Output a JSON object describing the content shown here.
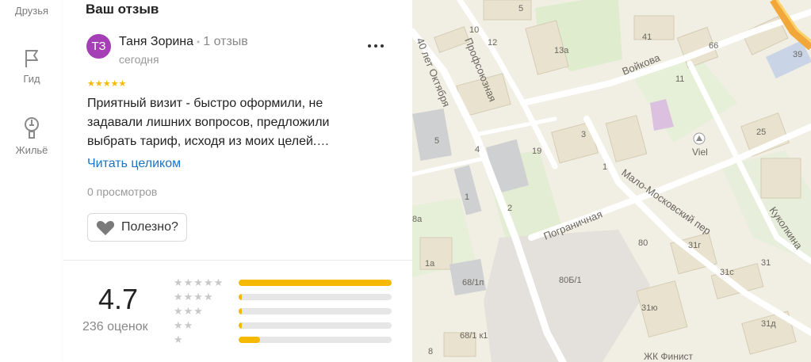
{
  "nav": {
    "friends": "Друзья",
    "guide": "Гид",
    "housing": "Жильё"
  },
  "review": {
    "section_title": "Ваш отзыв",
    "avatar_initials": "ТЗ",
    "author": "Таня Зорина",
    "author_reviews": "1 отзыв",
    "date": "сегодня",
    "stars": "★★★★★",
    "text_line1": "Приятный визит - быстро оформили, не",
    "text_line2": "задавали лишних вопросов, предложили",
    "text_line3": "выбрать тариф, исходя из моих целей.…",
    "read_more": "Читать целиком",
    "views": "0 просмотров",
    "useful": "Полезно?"
  },
  "rating": {
    "value": "4.7",
    "count": "236 оценок",
    "distribution": [
      {
        "stars": "★★★★★",
        "fraction": 1.0
      },
      {
        "stars": "★★★★",
        "fraction": 0.02
      },
      {
        "stars": "★★★",
        "fraction": 0.02
      },
      {
        "stars": "★★",
        "fraction": 0.02
      },
      {
        "stars": "★",
        "fraction": 0.14
      }
    ]
  },
  "map": {
    "streets": [
      "Профсоюзная",
      "40 лет Октября",
      "Войкова",
      "Пограничная",
      "Мало-Московский пер",
      "Куколкина"
    ],
    "numbers": [
      "5",
      "10",
      "12",
      "13а",
      "41",
      "66",
      "39",
      "11",
      "25",
      "3",
      "19",
      "4",
      "5",
      "1",
      "2",
      "1",
      "8а",
      "1а",
      "68/1п",
      "80Б/1",
      "80",
      "31г",
      "31с",
      "31ю",
      "31д",
      "31",
      "68/1 к1",
      "8"
    ],
    "poi": [
      "Viel",
      "ЖК Финист"
    ]
  },
  "colors": {
    "accent_yellow": "#f7b800",
    "link_blue": "#1a73c7",
    "avatar_purple": "#a43fb5"
  }
}
